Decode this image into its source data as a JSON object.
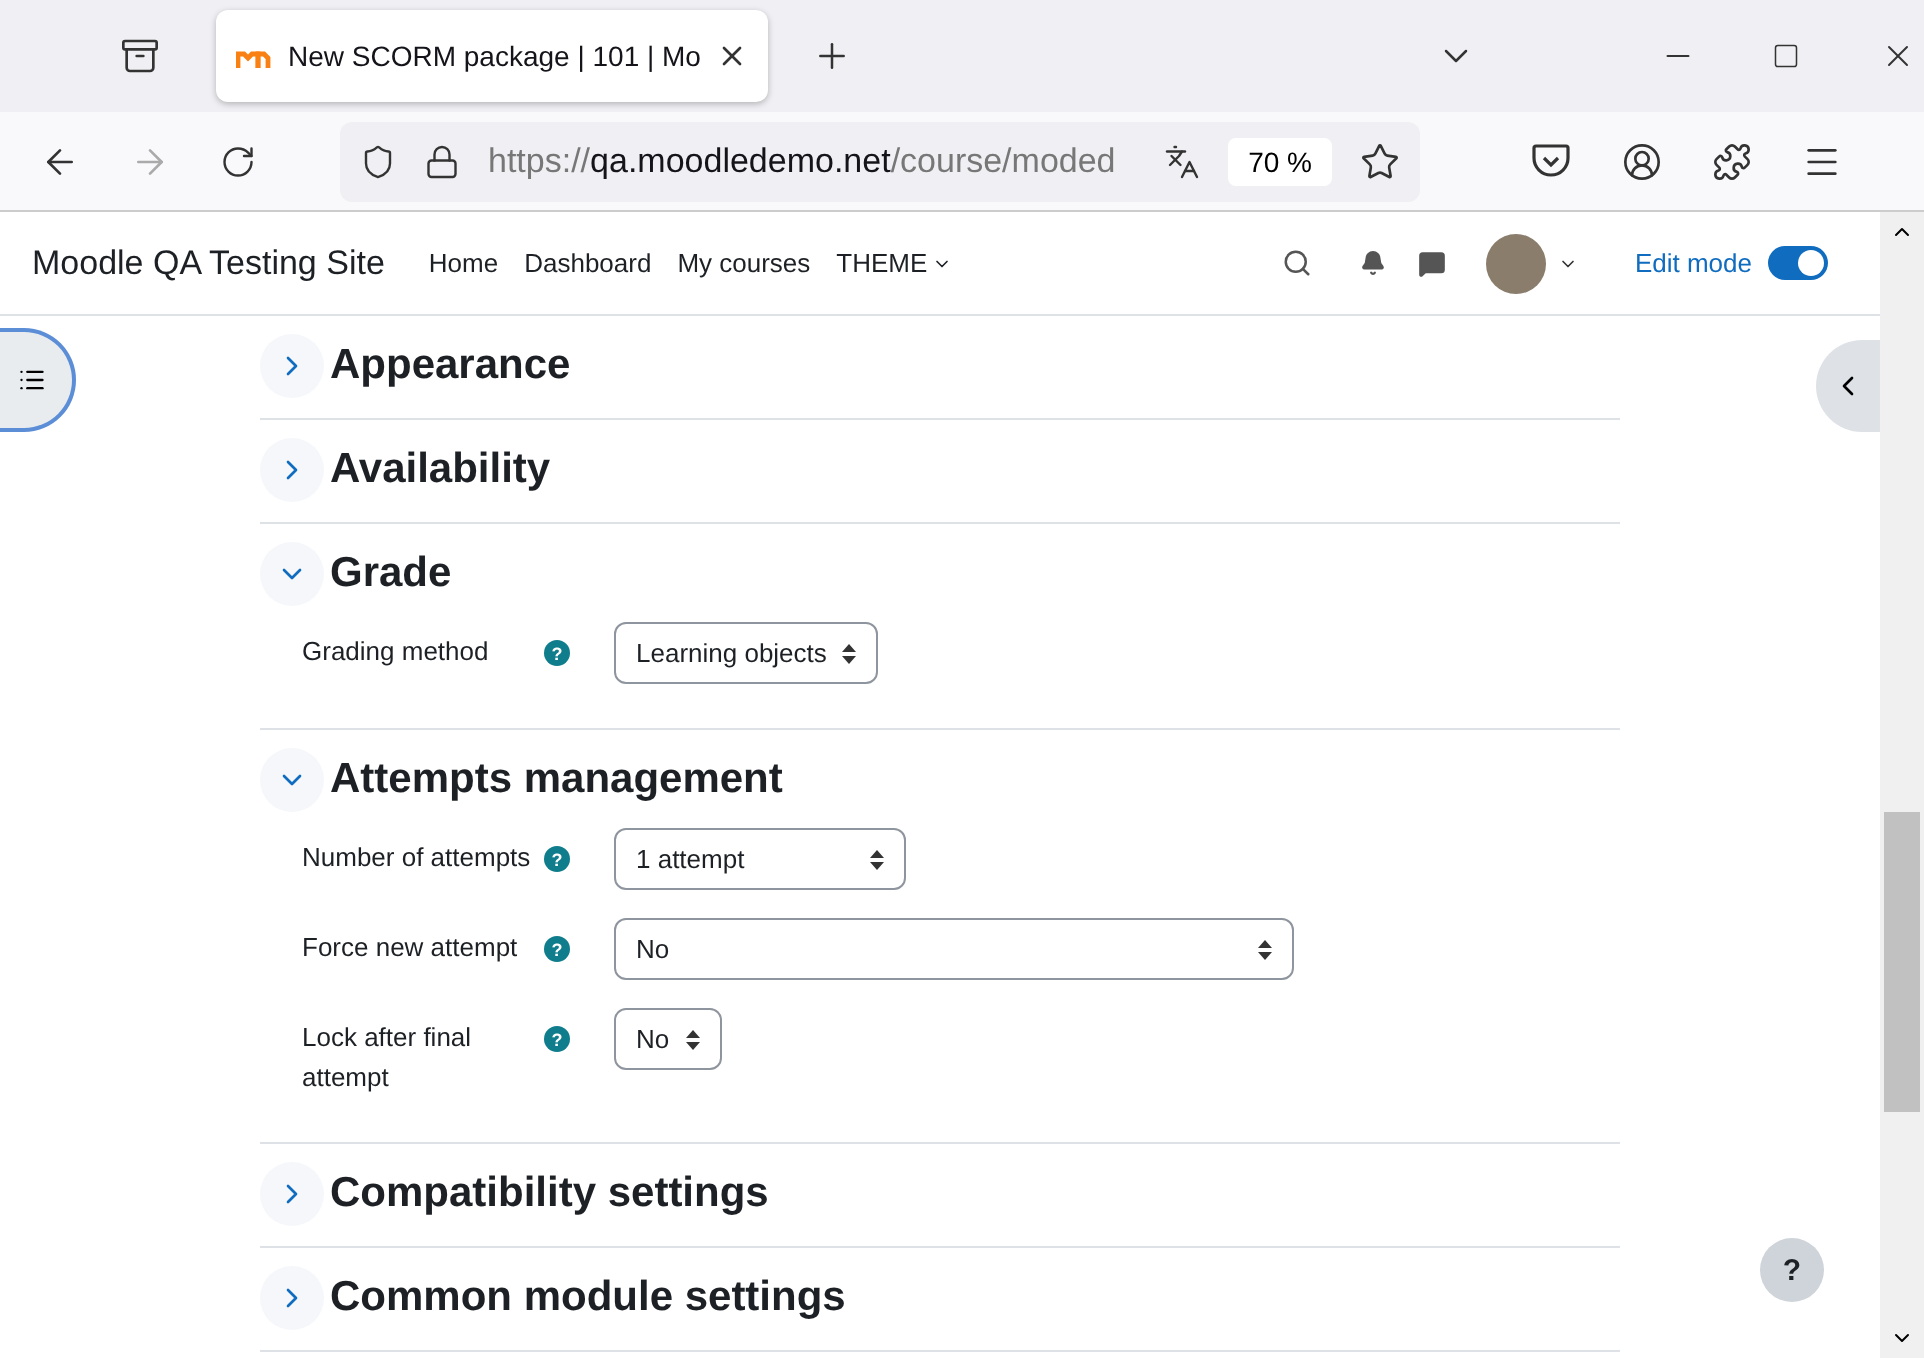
{
  "browser": {
    "tab_title": "New SCORM package | 101 | Mo",
    "url": {
      "scheme": "https://",
      "host": "qa.moodledemo.net",
      "path": "/course/moded"
    },
    "zoom": "70 %"
  },
  "navbar": {
    "site_name": "Moodle QA Testing Site",
    "links": [
      {
        "label": "Home",
        "kind": "link"
      },
      {
        "label": "Dashboard",
        "kind": "link"
      },
      {
        "label": "My courses",
        "kind": "link"
      },
      {
        "label": "THEME",
        "kind": "dropdown"
      }
    ],
    "edit_mode": {
      "label": "Edit mode",
      "on": true
    }
  },
  "sections": [
    {
      "title": "Appearance",
      "expanded": false
    },
    {
      "title": "Availability",
      "expanded": false
    },
    {
      "title": "Grade",
      "expanded": true,
      "fields": [
        {
          "label": "Grading method",
          "help": "?",
          "value": "Learning objects"
        }
      ]
    },
    {
      "title": "Attempts management",
      "expanded": true,
      "fields": [
        {
          "label": "Number of attempts",
          "help": "?",
          "value": "1 attempt"
        },
        {
          "label": "Force new attempt",
          "help": "?",
          "value": "No"
        },
        {
          "label": "Lock after final attempt",
          "help": "?",
          "value": "No"
        }
      ]
    },
    {
      "title": "Compatibility settings",
      "expanded": false
    },
    {
      "title": "Common module settings",
      "expanded": false
    }
  ],
  "help_button": "?"
}
